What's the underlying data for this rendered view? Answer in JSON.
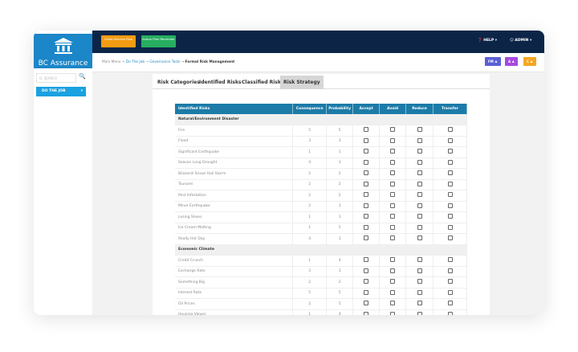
{
  "brand": {
    "name": "BC Assurance"
  },
  "sidebar": {
    "search_placeholder": "Q. SEARCH",
    "menu_label": "DO THE JOB"
  },
  "topbar": {
    "buttons": [
      {
        "label": "Client Service Plan",
        "color": "#f39c12"
      },
      {
        "label": "Action Plan Reminder",
        "color": "#27ae60"
      }
    ],
    "help": "HELP",
    "admin": "ADMIN"
  },
  "breadcrumb": [
    "Main Menu",
    "Do The Job",
    "Governance Tools",
    "Formal Risk Management"
  ],
  "user_badges": [
    {
      "label": "FM",
      "color": "#5b5fd6"
    },
    {
      "label": "A",
      "color": "#a54be0"
    },
    {
      "label": "C",
      "color": "#f5a623"
    }
  ],
  "tabs": [
    {
      "label": "Risk Categories"
    },
    {
      "label": "Identified Risks"
    },
    {
      "label": "Classified Risks"
    },
    {
      "label": "Risk Strategy",
      "active": true
    }
  ],
  "table": {
    "columns": [
      "Identified Risks",
      "Consequence",
      "Probability",
      "Accept",
      "Avoid",
      "Reduce",
      "Transfer"
    ],
    "groups": [
      {
        "name": "Natural/Environment Disaster",
        "rows": [
          [
            "Fire",
            5,
            5
          ],
          [
            "Flood",
            3,
            3
          ],
          [
            "Significant Earthquake",
            1,
            1
          ],
          [
            "Season Long Drought",
            4,
            3
          ],
          [
            "Blizzard/ Snow/ Hail Storm",
            2,
            2
          ],
          [
            "Tsunami",
            2,
            2
          ],
          [
            "Pest Infestation",
            2,
            2
          ],
          [
            "Minor Earthquake",
            2,
            3
          ],
          [
            "Losing Shoes",
            1,
            1
          ],
          [
            "Ice Cream Melting",
            1,
            5
          ],
          [
            "Really Hot Day",
            4,
            3
          ]
        ]
      },
      {
        "name": "Economic Climate",
        "rows": [
          [
            "Credit Crunch",
            1,
            4
          ],
          [
            "Exchange Rate",
            3,
            3
          ],
          [
            "Something Big",
            2,
            2
          ],
          [
            "Interest Rate",
            5,
            5
          ],
          [
            "Oil Prices",
            2,
            5
          ],
          [
            "Housing Values",
            1,
            4
          ]
        ]
      }
    ]
  }
}
